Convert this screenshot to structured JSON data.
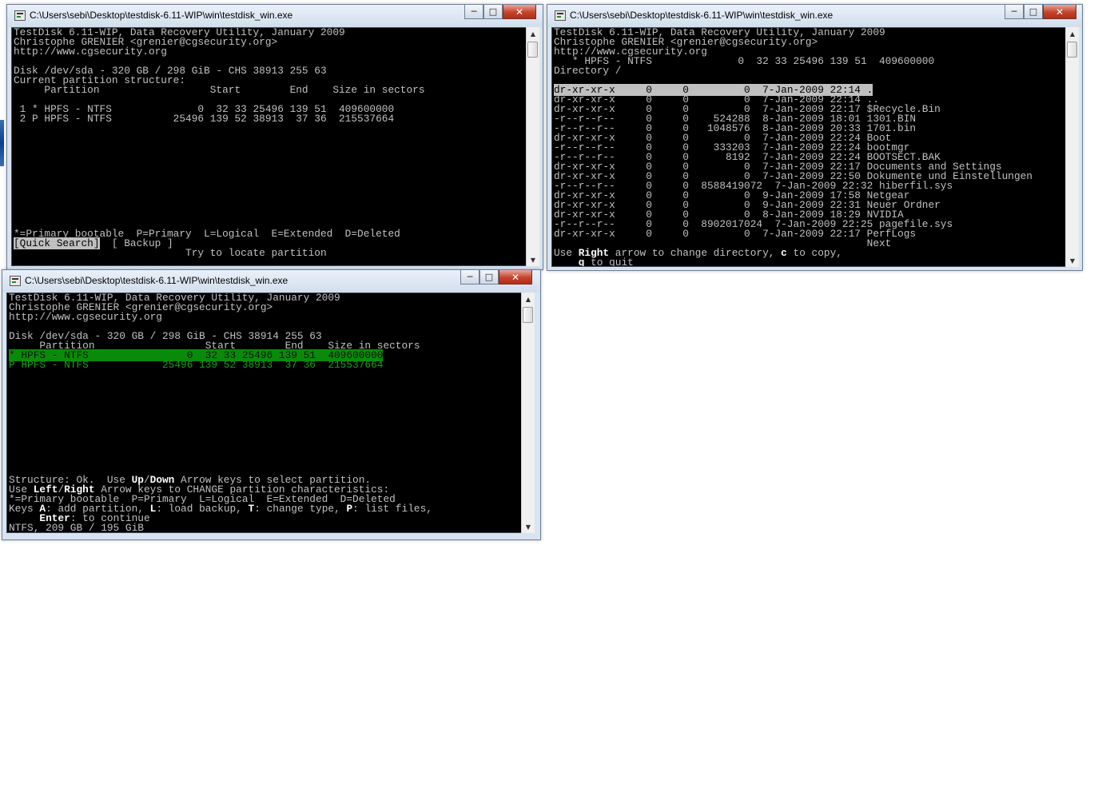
{
  "windows": [
    {
      "id": "w1",
      "title": "C:\\Users\\sebi\\Desktop\\testdisk-6.11-WIP\\win\\testdisk_win.exe",
      "lines": [
        [
          {
            "t": "TestDisk 6.11-WIP, Data Recovery Utility, January 2009"
          }
        ],
        [
          {
            "t": "Christophe GRENIER <grenier@cgsecurity.org>"
          }
        ],
        [
          {
            "t": "http://www.cgsecurity.org"
          }
        ],
        [
          {
            "t": ""
          }
        ],
        [
          {
            "t": "Disk /dev/sda - 320 GB / 298 GiB - CHS 38913 255 63"
          }
        ],
        [
          {
            "t": "Current partition structure:"
          }
        ],
        [
          {
            "t": "     Partition                  Start        End    Size in sectors"
          }
        ],
        [
          {
            "t": ""
          }
        ],
        [
          {
            "t": " 1 * HPFS - NTFS              0  32 33 25496 139 51  409600000"
          }
        ],
        [
          {
            "t": " 2 P HPFS - NTFS          25496 139 52 38913  37 36  215537664"
          }
        ],
        [
          {
            "t": ""
          }
        ],
        [
          {
            "t": ""
          }
        ],
        [
          {
            "t": ""
          }
        ],
        [
          {
            "t": ""
          }
        ],
        [
          {
            "t": ""
          }
        ],
        [
          {
            "t": ""
          }
        ],
        [
          {
            "t": ""
          }
        ],
        [
          {
            "t": ""
          }
        ],
        [
          {
            "t": ""
          }
        ],
        [
          {
            "t": ""
          }
        ],
        [
          {
            "t": ""
          }
        ],
        [
          {
            "t": "*=Primary bootable  P=Primary  L=Logical  E=Extended  D=Deleted"
          }
        ],
        [
          {
            "t": "[Quick Search]",
            "c": "sel-grey"
          },
          {
            "t": "  [ Backup ]"
          }
        ],
        [
          {
            "t": "                            Try to locate partition"
          }
        ]
      ]
    },
    {
      "id": "w2",
      "title": "C:\\Users\\sebi\\Desktop\\testdisk-6.11-WIP\\win\\testdisk_win.exe",
      "lines": [
        [
          {
            "t": "TestDisk 6.11-WIP, Data Recovery Utility, January 2009"
          }
        ],
        [
          {
            "t": "Christophe GRENIER <grenier@cgsecurity.org>"
          }
        ],
        [
          {
            "t": "http://www.cgsecurity.org"
          }
        ],
        [
          {
            "t": "   * HPFS - NTFS              0  32 33 25496 139 51  409600000"
          }
        ],
        [
          {
            "t": "Directory /"
          }
        ],
        [
          {
            "t": ""
          }
        ],
        [
          {
            "t": "dr-xr-xr-x     0     0         0  7-Jan-2009 22:14 .",
            "c": "sel-grey"
          }
        ],
        [
          {
            "t": "dr-xr-xr-x     0     0         0  7-Jan-2009 22:14 .."
          }
        ],
        [
          {
            "t": "dr-xr-xr-x     0     0         0  7-Jan-2009 22:17 $Recycle.Bin"
          }
        ],
        [
          {
            "t": "-r--r--r--     0     0    524288  8-Jan-2009 18:01 1301.BIN"
          }
        ],
        [
          {
            "t": "-r--r--r--     0     0   1048576  8-Jan-2009 20:33 1701.bin"
          }
        ],
        [
          {
            "t": "dr-xr-xr-x     0     0         0  7-Jan-2009 22:24 Boot"
          }
        ],
        [
          {
            "t": "-r--r--r--     0     0    333203  7-Jan-2009 22:24 bootmgr"
          }
        ],
        [
          {
            "t": "-r--r--r--     0     0      8192  7-Jan-2009 22:24 BOOTSECT.BAK"
          }
        ],
        [
          {
            "t": "dr-xr-xr-x     0     0         0  7-Jan-2009 22:17 Documents and Settings"
          }
        ],
        [
          {
            "t": "dr-xr-xr-x     0     0         0  7-Jan-2009 22:50 Dokumente und Einstellungen"
          }
        ],
        [
          {
            "t": "-r--r--r--     0     0  8588419072  7-Jan-2009 22:32 hiberfil.sys"
          }
        ],
        [
          {
            "t": "dr-xr-xr-x     0     0         0  9-Jan-2009 17:58 Netgear"
          }
        ],
        [
          {
            "t": "dr-xr-xr-x     0     0         0  9-Jan-2009 22:31 Neuer Ordner"
          }
        ],
        [
          {
            "t": "dr-xr-xr-x     0     0         0  8-Jan-2009 18:29 NVIDIA"
          }
        ],
        [
          {
            "t": "-r--r--r--     0     0  8902017024  7-Jan-2009 22:25 pagefile.sys"
          }
        ],
        [
          {
            "t": "dr-xr-xr-x     0     0         0  7-Jan-2009 22:17 PerfLogs"
          }
        ],
        [
          {
            "t": "                                                   Next"
          }
        ],
        [
          {
            "t": "Use "
          },
          {
            "t": "Right",
            "c": "b"
          },
          {
            "t": " arrow to change directory, "
          },
          {
            "t": "c",
            "c": "b"
          },
          {
            "t": " to copy,"
          }
        ],
        [
          {
            "t": "    "
          },
          {
            "t": "q",
            "c": "b"
          },
          {
            "t": " to quit"
          }
        ]
      ]
    },
    {
      "id": "w3",
      "title": "C:\\Users\\sebi\\Desktop\\testdisk-6.11-WIP\\win\\testdisk_win.exe",
      "lines": [
        [
          {
            "t": "TestDisk 6.11-WIP, Data Recovery Utility, January 2009"
          }
        ],
        [
          {
            "t": "Christophe GRENIER <grenier@cgsecurity.org>"
          }
        ],
        [
          {
            "t": "http://www.cgsecurity.org"
          }
        ],
        [
          {
            "t": ""
          }
        ],
        [
          {
            "t": "Disk /dev/sda - 320 GB / 298 GiB - CHS 38914 255 63"
          }
        ],
        [
          {
            "t": "     Partition                  Start        End    Size in sectors"
          }
        ],
        [
          {
            "t": "* HPFS - NTFS                0  32 33 25496 139 51  409600000",
            "c": "sel-green"
          }
        ],
        [
          {
            "t": "P HPFS - NTFS            25496 139 52 38913  37 36  215537664",
            "c": "green"
          }
        ],
        [
          {
            "t": ""
          }
        ],
        [
          {
            "t": ""
          }
        ],
        [
          {
            "t": ""
          }
        ],
        [
          {
            "t": ""
          }
        ],
        [
          {
            "t": ""
          }
        ],
        [
          {
            "t": ""
          }
        ],
        [
          {
            "t": ""
          }
        ],
        [
          {
            "t": ""
          }
        ],
        [
          {
            "t": ""
          }
        ],
        [
          {
            "t": ""
          }
        ],
        [
          {
            "t": ""
          }
        ],
        [
          {
            "t": "Structure: Ok.  Use "
          },
          {
            "t": "Up",
            "c": "b"
          },
          {
            "t": "/"
          },
          {
            "t": "Down",
            "c": "b"
          },
          {
            "t": " Arrow keys to select partition."
          }
        ],
        [
          {
            "t": "Use "
          },
          {
            "t": "Left",
            "c": "b"
          },
          {
            "t": "/"
          },
          {
            "t": "Right",
            "c": "b"
          },
          {
            "t": " Arrow keys to CHANGE partition characteristics:"
          }
        ],
        [
          {
            "t": "*=Primary bootable  P=Primary  L=Logical  E=Extended  D=Deleted"
          }
        ],
        [
          {
            "t": "Keys "
          },
          {
            "t": "A",
            "c": "b"
          },
          {
            "t": ": add partition, "
          },
          {
            "t": "L",
            "c": "b"
          },
          {
            "t": ": load backup, "
          },
          {
            "t": "T",
            "c": "b"
          },
          {
            "t": ": change type, "
          },
          {
            "t": "P",
            "c": "b"
          },
          {
            "t": ": list files,"
          }
        ],
        [
          {
            "t": "     "
          },
          {
            "t": "Enter",
            "c": "b"
          },
          {
            "t": ": to continue"
          }
        ],
        [
          {
            "t": "NTFS, 209 GB / 195 GiB"
          }
        ]
      ]
    }
  ],
  "controls": {
    "minimize": "─",
    "maximize": "□",
    "close": "✕"
  },
  "scroll": {
    "up": "▲",
    "down": "▼"
  }
}
